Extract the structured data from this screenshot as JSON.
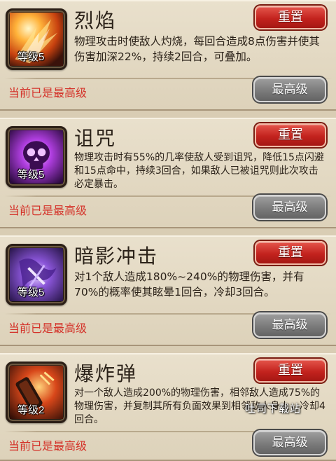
{
  "skills": [
    {
      "name": "烈焰",
      "level": "等级5",
      "description": "物理攻击时使敌人灼烧，每回合造成8点伤害并使其伤害加深22%，持续2回合，可叠加。",
      "reset_label": "重置",
      "status": "当前已是最高级",
      "max_label": "最高级",
      "icon": "flame-icon"
    },
    {
      "name": "诅咒",
      "level": "等级5",
      "description": "物理攻击时有55%的几率使敌人受到诅咒，降低15点闪避和15点命中，持续3回合，如果敌人已被诅咒则此次攻击必定暴击。",
      "reset_label": "重置",
      "status": "当前已是最高级",
      "max_label": "最高级",
      "icon": "skull-curse-icon"
    },
    {
      "name": "暗影冲击",
      "level": "等级5",
      "description": "对1个敌人造成180%~240%的物理伤害，并有70%的概率使其眩晕1回合，冷却3回合。",
      "reset_label": "重置",
      "status": "当前已是最高级",
      "max_label": "最高级",
      "icon": "shadow-strike-icon"
    },
    {
      "name": "爆炸弹",
      "level": "等级2",
      "description": "对一个敌人造成200%的物理伤害，相邻敌人造成75%的物理伤害，并复制其所有负面效果到相邻敌人身上，冷却4回合。",
      "reset_label": "重置",
      "status": "当前已是最高级",
      "max_label": "最高级",
      "icon": "bomb-icon"
    }
  ],
  "watermark": "吐司下载站",
  "colors": {
    "reset_button": "#c3231e",
    "max_button": "#7b7b7b",
    "status_text": "#d4332a",
    "panel_bg": "#e4dac4"
  }
}
